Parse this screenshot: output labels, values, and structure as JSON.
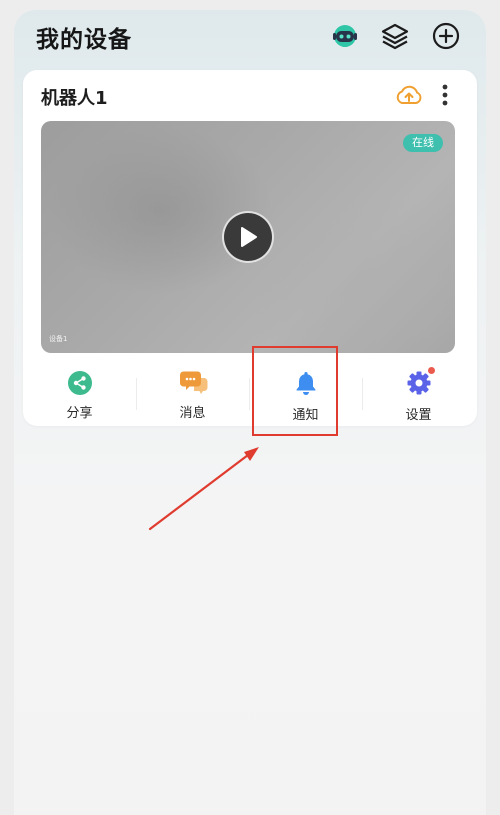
{
  "header": {
    "title": "我的设备",
    "icons": [
      "robot-assistant-icon",
      "layers-icon",
      "add-circle-icon"
    ]
  },
  "device_card": {
    "name": "机器人1",
    "icons": [
      "cloud-upload-icon",
      "more-vertical-icon"
    ],
    "video": {
      "status_badge": "在线",
      "camera_label": "设备1",
      "play_icon": "play-icon"
    }
  },
  "actions": [
    {
      "label": "分享",
      "icon": "share-icon",
      "color": "#3dbb8e"
    },
    {
      "label": "消息",
      "icon": "chat-bubbles-icon",
      "color": "#f0a040"
    },
    {
      "label": "通知",
      "icon": "bell-icon",
      "color": "#3d8ef0"
    },
    {
      "label": "设置",
      "icon": "gear-icon",
      "color": "#5a63e8",
      "has_badge": true
    }
  ],
  "annotation": {
    "highlight_color": "#e03b2f",
    "target": "通知"
  },
  "colors": {
    "accent_green": "#3fbfae",
    "upload_orange": "#f0a030"
  }
}
